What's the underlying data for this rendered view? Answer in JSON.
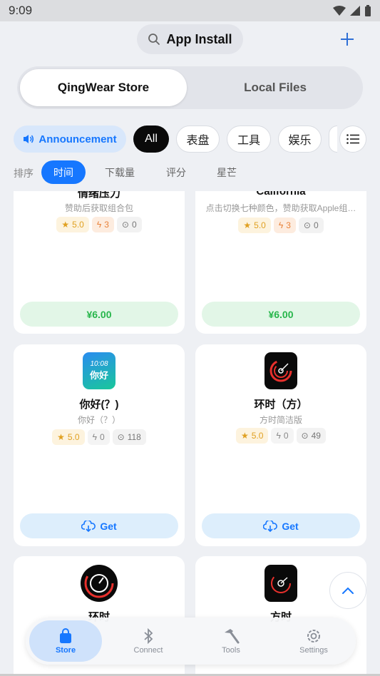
{
  "status": {
    "time": "9:09"
  },
  "header": {
    "title": "App Install"
  },
  "segment": {
    "store": "QingWear Store",
    "local": "Local Files"
  },
  "chips": {
    "announcement": "Announcement",
    "all": "All",
    "c1": "表盘",
    "c2": "工具",
    "c3": "娱乐"
  },
  "sort": {
    "label": "排序",
    "options": [
      "时间",
      "下载量",
      "评分",
      "星芒"
    ]
  },
  "cards": [
    {
      "title": "情绪压力",
      "subtitle": "赞助后获取组合包",
      "rating": "5.0",
      "fire": "3",
      "downloads": "0",
      "button": "¥6.00"
    },
    {
      "title": "California",
      "subtitle": "点击切换七种颜色，赞助获取Apple组…",
      "rating": "5.0",
      "fire": "3",
      "downloads": "0",
      "button": "¥6.00"
    },
    {
      "title": "你好(？)",
      "subtitle": "你好（？）",
      "icon_text1": "10:08",
      "icon_text2": "你好",
      "rating": "5.0",
      "fire": "0",
      "downloads": "118",
      "button": "Get"
    },
    {
      "title": "环时（方）",
      "subtitle": "方时简洁版",
      "rating": "5.0",
      "fire": "0",
      "downloads": "49",
      "button": "Get"
    },
    {
      "title": "环时"
    },
    {
      "title": "方时"
    }
  ],
  "nav": {
    "store": "Store",
    "connect": "Connect",
    "tools": "Tools",
    "settings": "Settings"
  },
  "colors": {
    "accent": "#1677ff",
    "price": "#27b64b",
    "star": "#e0a021"
  }
}
